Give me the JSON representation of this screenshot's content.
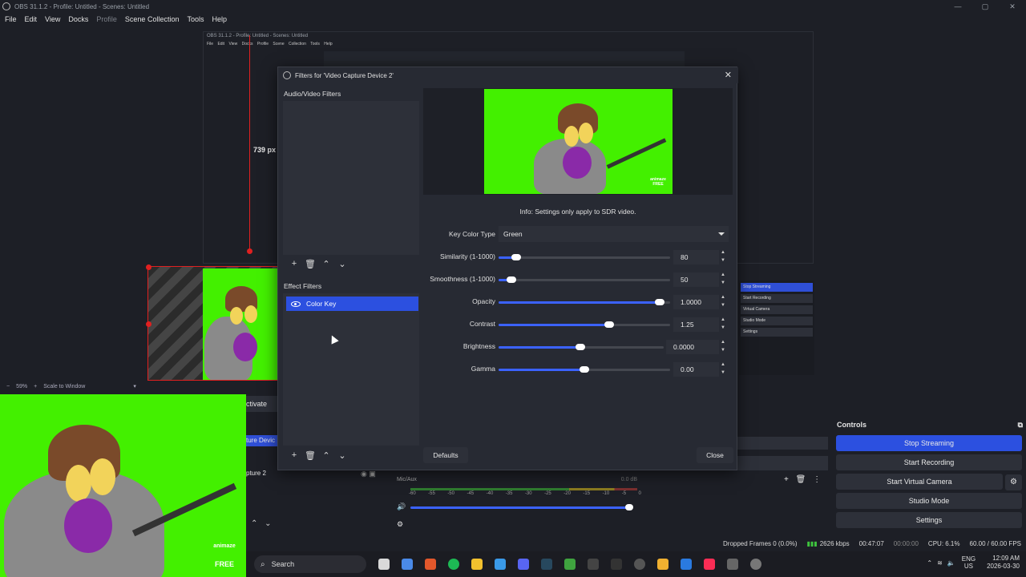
{
  "window": {
    "title": "OBS 31.1.2 - Profile: Untitled - Scenes: Untitled",
    "controls": [
      "—",
      "▢",
      "✕"
    ]
  },
  "menu": [
    "File",
    "Edit",
    "View",
    "Docks",
    "Profile",
    "Scene Collection",
    "Tools",
    "Help"
  ],
  "nested": {
    "title": "OBS 31.1.2 - Profile: Untitled - Scenes: Untitled",
    "menu": "File Edit View Docks Profile Scene Collection Tools Help",
    "buttons": [
      "Stop Streaming",
      "Start Recording",
      "Virtual Camera",
      "Studio Mode",
      "Settings"
    ]
  },
  "canvas": {
    "height_label": "739 px",
    "zoom": "59%",
    "scale_mode": "Scale to Window"
  },
  "scenes_dock": {
    "activate_label": "ctivate",
    "source1": "ture Devic",
    "source2": "pture 2"
  },
  "mixer": {
    "name": "Mic/Aux",
    "db": "0.0 dB",
    "scale": [
      "-60",
      "-55",
      "-50",
      "-45",
      "-40",
      "-35",
      "-30",
      "-25",
      "-20",
      "-15",
      "-10",
      "-5",
      "0"
    ]
  },
  "controls": {
    "header": "Controls",
    "stop_streaming": "Stop Streaming",
    "start_recording": "Start Recording",
    "start_virtual_camera": "Start Virtual Camera",
    "studio_mode": "Studio Mode",
    "settings": "Settings"
  },
  "statusbar": {
    "dropped": "Dropped Frames 0 (0.0%)",
    "bitrate": "2626 kbps",
    "stream_time": "00:47:07",
    "rec_time": "00:00:00",
    "cpu": "CPU: 6.1%",
    "fps": "60.00 / 60.00 FPS"
  },
  "dialog": {
    "title": "Filters for 'Video Capture Device 2'",
    "audio_video_label": "Audio/Video Filters",
    "effect_label": "Effect Filters",
    "filter_item": "Color Key",
    "info": "Info: Settings only apply to SDR video.",
    "key_color_type_label": "Key Color Type",
    "key_color_type_value": "Green",
    "similarity_label": "Similarity (1-1000)",
    "similarity_value": "80",
    "smoothness_label": "Smoothness (1-1000)",
    "smoothness_value": "50",
    "opacity_label": "Opacity",
    "opacity_value": "1.0000",
    "contrast_label": "Contrast",
    "contrast_value": "1.25",
    "brightness_label": "Brightness",
    "brightness_value": "0.0000",
    "gamma_label": "Gamma",
    "gamma_value": "0.00",
    "defaults": "Defaults",
    "close": "Close"
  },
  "logo": {
    "line1": "animaze",
    "line2": "FREE"
  },
  "taskbar": {
    "search": "Search",
    "lang1": "ENG",
    "lang2": "US",
    "time": "12:09 AM",
    "date": "2026-03-30"
  },
  "colors": {
    "accent": "#2c50e0",
    "chroma": "#43f000",
    "guide": "#e02020"
  }
}
